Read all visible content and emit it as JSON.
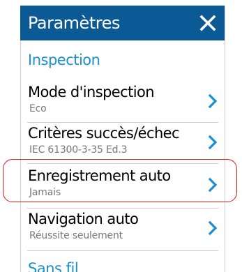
{
  "header": {
    "title": "Paramètres",
    "close_icon": "close-icon"
  },
  "sections": {
    "inspection": "Inspection",
    "wireless": "Sans fil"
  },
  "items": [
    {
      "label": "Mode d'inspection",
      "value": "Eco"
    },
    {
      "label": "Critères succès/échec",
      "value": "IEC 61300-3-35 Ed.3"
    },
    {
      "label": "Enregistrement auto",
      "value": "Jamais"
    },
    {
      "label": "Navigation auto",
      "value": "Réussite seulement"
    }
  ],
  "colors": {
    "header_bg": "#0b5a96",
    "accent": "#1a8fd3",
    "highlight": "#d91a1a"
  }
}
